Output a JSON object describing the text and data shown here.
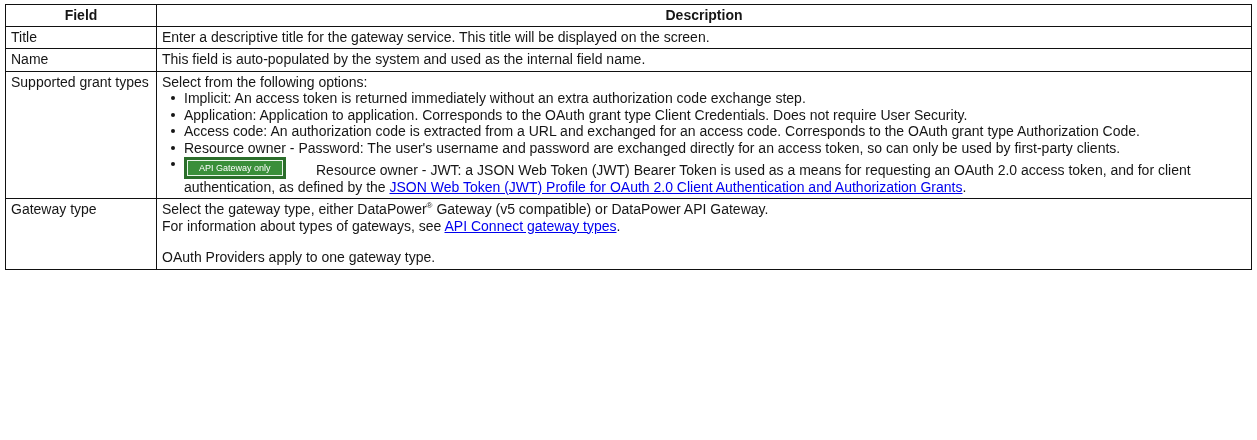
{
  "table": {
    "columns": [
      "Field",
      "Description"
    ],
    "rows": [
      {
        "field": "Title",
        "blocks": [
          {
            "kind": "para",
            "parts": [
              {
                "kind": "text",
                "text": "Enter a descriptive title for the gateway service. This title will be displayed on the screen."
              }
            ]
          }
        ]
      },
      {
        "field": "Name",
        "blocks": [
          {
            "kind": "para",
            "parts": [
              {
                "kind": "text",
                "text": "This field is auto-populated by the system and used as the internal field name."
              }
            ]
          }
        ]
      },
      {
        "field": "Supported grant types",
        "blocks": [
          {
            "kind": "para",
            "parts": [
              {
                "kind": "text",
                "text": "Select from the following options:"
              }
            ]
          },
          {
            "kind": "list",
            "items": [
              {
                "parts": [
                  {
                    "kind": "text",
                    "text": "Implicit: An access token is returned immediately without an extra authorization code exchange step."
                  }
                ]
              },
              {
                "parts": [
                  {
                    "kind": "text",
                    "text": "Application: Application to application. Corresponds to the OAuth grant type Client Credentials. Does not require User Security."
                  }
                ]
              },
              {
                "parts": [
                  {
                    "kind": "text",
                    "text": "Access code: An authorization code is extracted from a URL and exchanged for an access code. Corresponds to the OAuth grant type Authorization Code."
                  }
                ]
              },
              {
                "parts": [
                  {
                    "kind": "text",
                    "text": "Resource owner - Password: The user's username and password are exchanged directly for an access token, so can only be used by first-party clients."
                  }
                ]
              },
              {
                "badge": "API Gateway only",
                "parts": [
                  {
                    "kind": "text",
                    "text": "Resource owner - JWT: a JSON Web Token (JWT) Bearer Token is used as a means for requesting an OAuth 2.0 access token, and for client authentication, as defined by the "
                  },
                  {
                    "kind": "link",
                    "text": "JSON Web Token (JWT) Profile for OAuth 2.0 Client Authentication and Authorization Grants"
                  },
                  {
                    "kind": "text",
                    "text": "."
                  }
                ]
              }
            ]
          }
        ]
      },
      {
        "field": "Gateway type",
        "blocks": [
          {
            "kind": "para",
            "parts": [
              {
                "kind": "text",
                "text": "Select the gateway type, either DataPower$^{®}$ Gateway (v5 compatible) or DataPower API Gateway."
              }
            ]
          },
          {
            "kind": "para",
            "parts": [
              {
                "kind": "text",
                "text": "For information about types of gateways, see "
              },
              {
                "kind": "link",
                "text": "API Connect gateway types"
              },
              {
                "kind": "text",
                "text": "."
              }
            ]
          },
          {
            "kind": "note",
            "parts": [
              {
                "kind": "text",
                "text": "OAuth Providers apply to one gateway type."
              }
            ]
          }
        ]
      }
    ]
  }
}
